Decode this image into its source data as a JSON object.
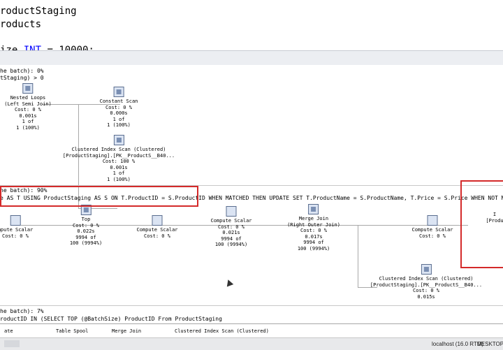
{
  "editor": {
    "line1": "roductStaging",
    "line2": "roducts",
    "line3_prefix": "ize",
    "line3_kw": "INT",
    "line3_val": "= 10000;"
  },
  "stmt1": {
    "header1": "he batch): 0%",
    "header2": "tStaging) > 0",
    "nodes": [
      {
        "name": "Nested Loops",
        "sub": "(Left Semi Join)",
        "cost": "Cost: 0 %",
        "time": "0.001s",
        "rows": "1 of",
        "pct": "1 (100%)"
      },
      {
        "name": "Constant Scan",
        "cost": "Cost: 0 %",
        "time": "0.000s",
        "rows": "1 of",
        "pct": "1 (100%)"
      },
      {
        "name": "Clustered Index Scan (Clustered)",
        "sub": "[ProductStaging].[PK__ProductS__B40...",
        "cost": "Cost: 100 %",
        "time": "0.001s",
        "rows": "1 of",
        "pct": "1 (100%)"
      }
    ]
  },
  "stmt2": {
    "header1": "he batch): 90%",
    "header2": "e AS T USING ProductStaging AS S ON T.ProductID = S.ProductID WHEN MATCHED THEN UPDATE SET T.ProductName = S.ProductName, T.Price = S.Price WHEN NOT MATCHED",
    "nodes": [
      {
        "name": "mpute Scalar",
        "cost": "Cost: 0 %"
      },
      {
        "name": "Top",
        "cost": "Cost: 0 %",
        "time": "0.022s",
        "rows": "9994 of",
        "pct": "100 (9994%)"
      },
      {
        "name": "Compute Scalar",
        "cost": "Cost: 0 %"
      },
      {
        "name": "Compute Scalar",
        "cost": "Cost: 0 %",
        "time": "0.021s",
        "rows": "9994 of",
        "pct": "100 (9994%)"
      },
      {
        "name": "Merge Join",
        "sub": "(Right Outer Join)",
        "cost": "Cost: 0 %",
        "time": "0.017s",
        "rows": "9994 of",
        "pct": "100 (9994%)"
      },
      {
        "name": "Compute Scalar",
        "cost": "Cost: 0 %"
      },
      {
        "name": "I",
        "sub": "[Produ"
      },
      {
        "name": "Clustered Index Scan (Clustered)",
        "sub": "[ProductStaging].[PK__ProductS__B40...",
        "cost": "Cost: 0 %",
        "time": "0.015s"
      }
    ]
  },
  "stmt3": {
    "header1": "he batch): 7%",
    "header2": "roductID IN (SELECT TOP (@BatchSize) ProductID From ProductStaging",
    "peek": [
      "ate",
      "Table Spool",
      "Merge Join",
      "Clustered Index Scan (Clustered)"
    ]
  },
  "status": {
    "server": "localhost (16.0 RTM)",
    "machine": "DESKTOP-1"
  },
  "colors": {
    "highlight": "#d42a2a",
    "code_keyword": "#0000ff"
  }
}
